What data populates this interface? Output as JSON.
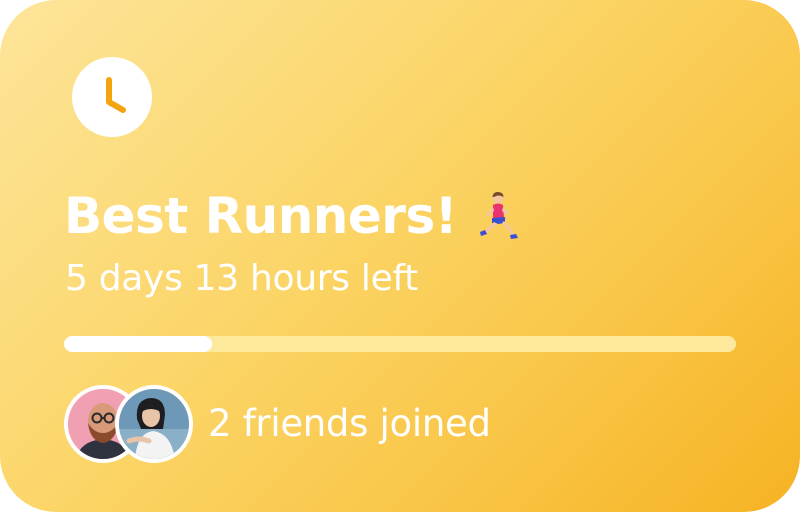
{
  "card": {
    "icon": "clock-icon",
    "title": "Best Runners!",
    "title_icon": "runner-emoji-icon",
    "time_left": "5 days 13 hours left",
    "progress": 0.22,
    "friends": {
      "avatars": [
        {
          "icon": "avatar-man-glasses"
        },
        {
          "icon": "avatar-woman"
        }
      ],
      "label": "2 friends joined"
    }
  },
  "colors": {
    "gradient_start": "#fde59a",
    "gradient_end": "#f6b323",
    "clock_accent": "#f3a40f",
    "progress_track": "#fde99c",
    "progress_fill": "#ffffff"
  }
}
